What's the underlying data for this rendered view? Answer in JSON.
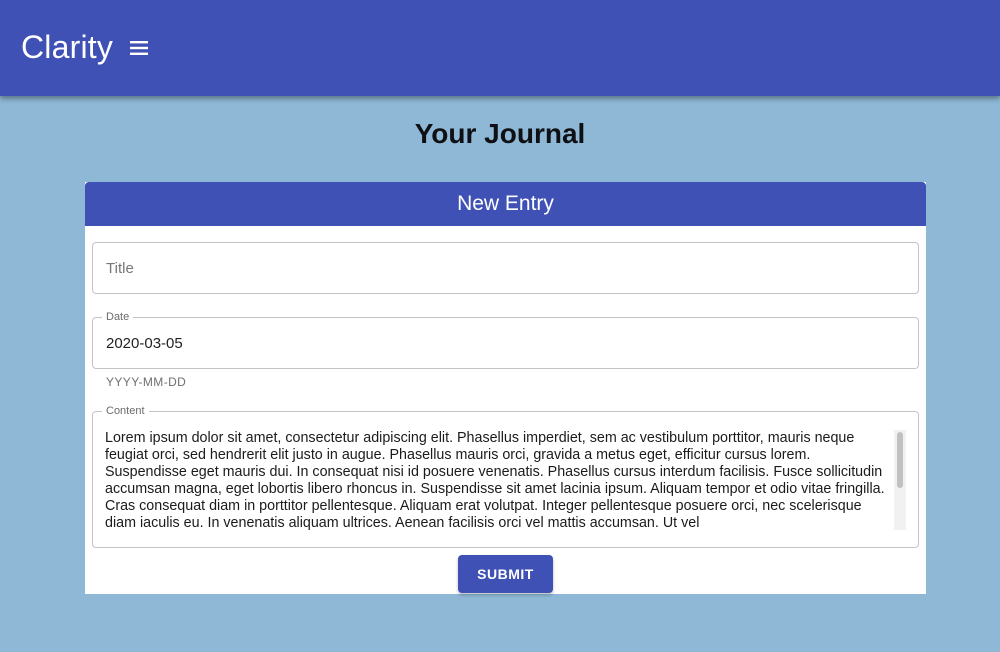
{
  "app": {
    "title": "Clarity",
    "menu_icon": "menu-icon",
    "brand_color": "#3f51b5",
    "background_color": "#8fb8d6"
  },
  "page": {
    "title": "Your Journal"
  },
  "card": {
    "header": "New Entry"
  },
  "form": {
    "title_placeholder": "Title",
    "title_value": "",
    "date_label": "Date",
    "date_value": "2020-03-05",
    "date_helper": "YYYY-MM-DD",
    "content_label": "Content",
    "content_value": "Lorem ipsum dolor sit amet, consectetur adipiscing elit. Phasellus imperdiet, sem ac vestibulum porttitor, mauris neque feugiat orci, sed hendrerit elit justo in augue. Phasellus mauris orci, gravida a metus eget, efficitur cursus lorem. Suspendisse eget mauris dui. In consequat nisi id posuere venenatis. Phasellus cursus interdum facilisis. Fusce sollicitudin accumsan magna, eget lobortis libero rhoncus in. Suspendisse sit amet lacinia ipsum. Aliquam tempor et odio vitae fringilla. Cras consequat diam in porttitor pellentesque. Aliquam erat volutpat. Integer pellentesque posuere orci, nec scelerisque diam iaculis eu. In venenatis aliquam ultrices. Aenean facilisis orci vel mattis accumsan. Ut vel",
    "submit_label": "SUBMIT"
  }
}
